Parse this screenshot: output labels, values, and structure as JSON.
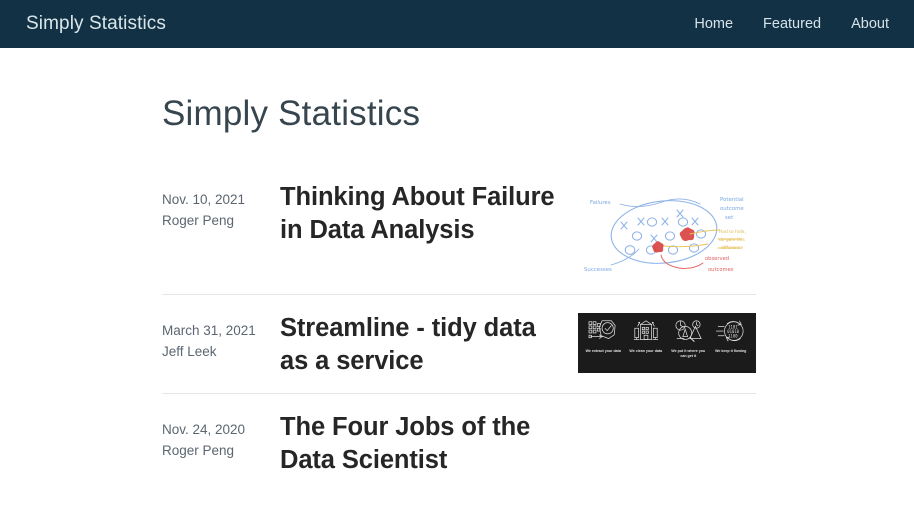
{
  "navbar": {
    "brand": "Simply Statistics",
    "links": [
      {
        "label": "Home"
      },
      {
        "label": "Featured"
      },
      {
        "label": "About"
      }
    ],
    "background_color": "#123144",
    "text_color": "#d9e6ea"
  },
  "page": {
    "title": "Simply Statistics",
    "title_color": "#36454e",
    "background_color": "#ffffff"
  },
  "posts": [
    {
      "date": "Nov. 10, 2021",
      "author": "Roger Peng",
      "title": "Thinking About Failure in Data Analysis",
      "thumbnail": {
        "type": "hand-drawn-diagram",
        "background": "#ffffff",
        "annotations": [
          {
            "text": "Failures",
            "color": "#7aa7e0"
          },
          {
            "text": "Successes",
            "color": "#7aa7e0"
          },
          {
            "text": "Potential outcome set",
            "color": "#7aa7e0"
          },
          {
            "text": "Hard to hide, do gain this difference",
            "color": "#e8c15a"
          },
          {
            "text": "observed outcomes",
            "color": "#e05a5a"
          }
        ],
        "marks": {
          "x_and_o": "X and O symbols inside ellipse",
          "blobs": "two red scribble blobs"
        }
      }
    },
    {
      "date": "March 31, 2021",
      "author": "Jeff Leek",
      "title": "Streamline - tidy data as a service",
      "thumbnail": {
        "type": "dark-icon-banner",
        "background": "#1b1b1b",
        "cells": [
          {
            "icon": "data-extract-icon",
            "caption": "We extract your data"
          },
          {
            "icon": "data-clean-icon",
            "caption": "We clean your data"
          },
          {
            "icon": "data-access-icon",
            "caption": "We put it where you can get it"
          },
          {
            "icon": "data-flow-icon",
            "caption": "We keep it flowing"
          }
        ]
      }
    },
    {
      "date": "Nov. 24, 2020",
      "author": "Roger Peng",
      "title": "The Four Jobs of the Data Scientist",
      "thumbnail": null
    }
  ]
}
